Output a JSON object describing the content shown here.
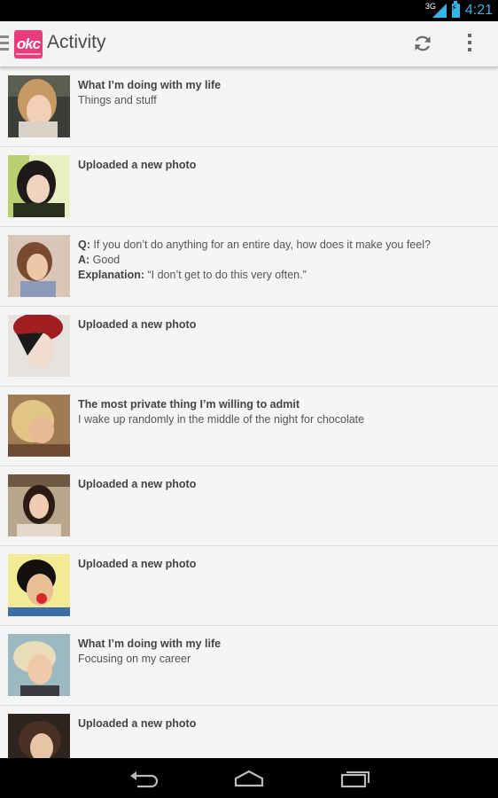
{
  "status_bar": {
    "network": "3G",
    "time": "4:21",
    "accent_color": "#33b5e5"
  },
  "action_bar": {
    "logo_text": "okc",
    "title": "Activity",
    "refresh_icon": "refresh-icon",
    "overflow_icon": "overflow-menu-icon",
    "brand_color": "#e73b7e"
  },
  "feed": [
    {
      "avatar": "avatar-1",
      "title": "What I’m doing with my life",
      "body": "Things and stuff"
    },
    {
      "avatar": "avatar-2",
      "title": "Uploaded a new photo",
      "body": ""
    },
    {
      "avatar": "avatar-3",
      "q_label": "Q:",
      "question": " If you don’t do anything for an entire day, how does it make you feel?",
      "a_label": "A:",
      "answer": " Good",
      "e_label": "Explanation:",
      "explanation": " “I don’t get to do this very often.”"
    },
    {
      "avatar": "avatar-4",
      "title": "Uploaded a new photo",
      "body": ""
    },
    {
      "avatar": "avatar-5",
      "title": "The most private thing I’m willing to admit",
      "body": "I wake up randomly in the middle of the night for chocolate"
    },
    {
      "avatar": "avatar-6",
      "title": "Uploaded a new photo",
      "body": ""
    },
    {
      "avatar": "avatar-7",
      "title": "Uploaded a new photo",
      "body": ""
    },
    {
      "avatar": "avatar-8",
      "title": "What I’m doing with my life",
      "body": "Focusing on my career"
    },
    {
      "avatar": "avatar-9",
      "title": "Uploaded a new photo",
      "body": ""
    }
  ],
  "nav_bar": {
    "back_icon": "back-icon",
    "home_icon": "home-icon",
    "recents_icon": "recent-apps-icon"
  }
}
